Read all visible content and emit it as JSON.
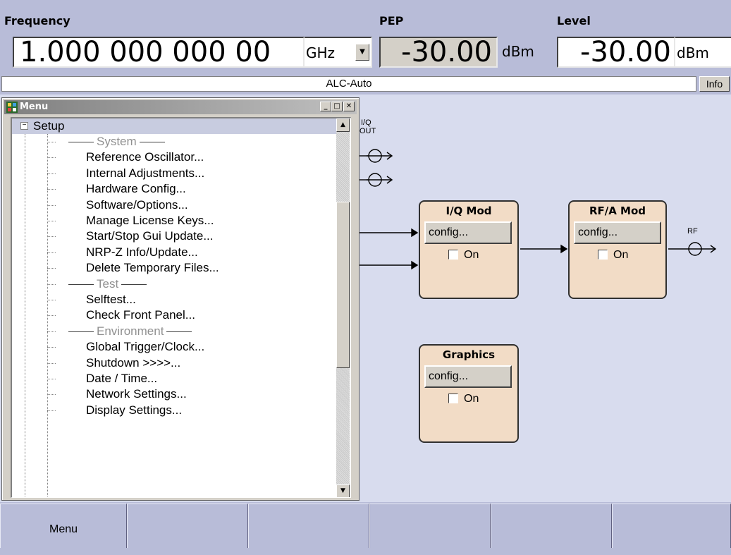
{
  "header": {
    "frequency_label": "Frequency",
    "frequency_value": "1.000 000 000 00",
    "frequency_unit": "GHz",
    "pep_label": "PEP",
    "pep_value": "-30.00",
    "pep_unit": "dBm",
    "level_label": "Level",
    "level_value": "-30.00",
    "level_unit": "dBm"
  },
  "status": {
    "text": "ALC-Auto",
    "info_button": "Info"
  },
  "menu_window": {
    "title": "Menu",
    "root": "Setup",
    "rows": [
      {
        "kind": "section",
        "label": "System"
      },
      {
        "kind": "item",
        "label": "Reference Oscillator..."
      },
      {
        "kind": "item",
        "label": "Internal Adjustments..."
      },
      {
        "kind": "item",
        "label": "Hardware Config..."
      },
      {
        "kind": "item",
        "label": "Software/Options..."
      },
      {
        "kind": "item",
        "label": "Manage License Keys..."
      },
      {
        "kind": "item",
        "label": "Start/Stop Gui Update..."
      },
      {
        "kind": "item",
        "label": "NRP-Z Info/Update..."
      },
      {
        "kind": "item",
        "label": "Delete Temporary Files..."
      },
      {
        "kind": "section",
        "label": "Test"
      },
      {
        "kind": "item",
        "label": "Selftest..."
      },
      {
        "kind": "item",
        "label": "Check Front Panel..."
      },
      {
        "kind": "section",
        "label": "Environment"
      },
      {
        "kind": "item",
        "label": "Global Trigger/Clock..."
      },
      {
        "kind": "item",
        "label": "Shutdown >>>>..."
      },
      {
        "kind": "item",
        "label": "Date / Time..."
      },
      {
        "kind": "item",
        "label": "Network Settings..."
      },
      {
        "kind": "item",
        "label": "Display Settings..."
      }
    ]
  },
  "diagram": {
    "iq_out_label_1": "I/Q",
    "iq_out_label_2": "OUT",
    "rf_label": "RF",
    "blocks": {
      "iq_mod": {
        "title": "I/Q Mod",
        "config": "config...",
        "on": "On"
      },
      "rfa_mod": {
        "title": "RF/A Mod",
        "config": "config...",
        "on": "On"
      },
      "graphics": {
        "title": "Graphics",
        "config": "config...",
        "on": "On"
      }
    }
  },
  "softkeys": [
    "Menu",
    "",
    "",
    "",
    "",
    ""
  ]
}
